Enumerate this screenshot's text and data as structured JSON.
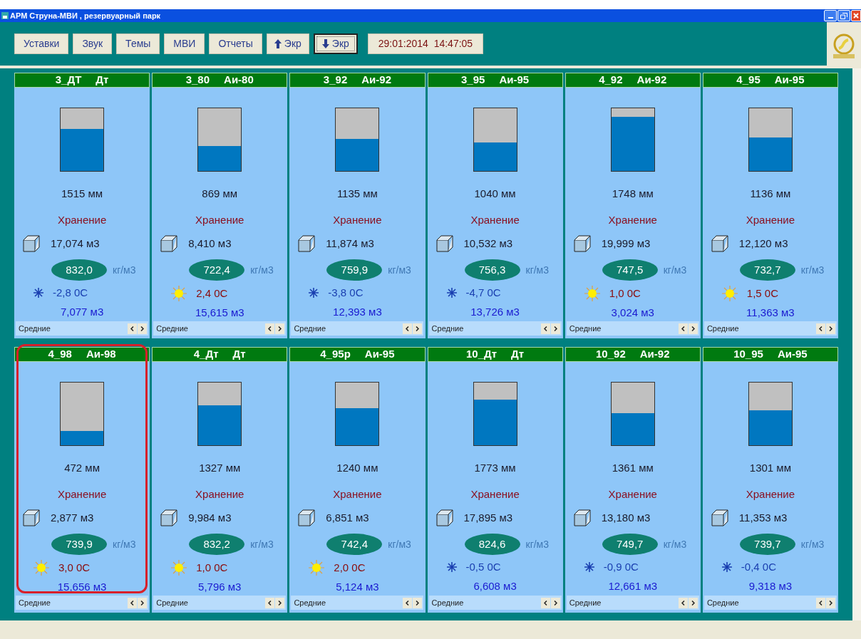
{
  "window": {
    "title": "АРМ Струна-МВИ ,  резервуарный  парк"
  },
  "toolbar": {
    "buttons": [
      {
        "label": "Уставки",
        "kind": "text"
      },
      {
        "label": "Звук",
        "kind": "text"
      },
      {
        "label": "Темы",
        "kind": "text"
      },
      {
        "label": "МВИ",
        "kind": "text"
      },
      {
        "label": "Отчеты",
        "kind": "text"
      },
      {
        "label": "Экр",
        "kind": "up",
        "selected": false
      },
      {
        "label": "Экр",
        "kind": "down",
        "selected": true
      }
    ],
    "datetime": "29:01:2014  14:47:05"
  },
  "tanks": [
    {
      "name": "3_ДТ",
      "product": "Дт",
      "level": 0.67,
      "height": "1515 мм",
      "mode": "Хранение",
      "volume": "17,074 м3",
      "density": "832,0",
      "density_unit": "кг/м3",
      "frost": true,
      "temperature": "-2,8 0С",
      "free_volume": "7,077 м3",
      "footer": "Средние",
      "selected": false
    },
    {
      "name": "3_80",
      "product": "Аи-80",
      "level": 0.4,
      "height": "869 мм",
      "mode": "Хранение",
      "volume": "8,410 м3",
      "density": "722,4",
      "density_unit": "кг/м3",
      "frost": false,
      "temperature": "2,4 0С",
      "free_volume": "15,615 м3",
      "footer": "Средние",
      "selected": false
    },
    {
      "name": "3_92",
      "product": "Аи-92",
      "level": 0.51,
      "height": "1135 мм",
      "mode": "Хранение",
      "volume": "11,874 м3",
      "density": "759,9",
      "density_unit": "кг/м3",
      "frost": true,
      "temperature": "-3,8 0С",
      "free_volume": "12,393 м3",
      "footer": "Средние",
      "selected": false
    },
    {
      "name": "3_95",
      "product": "Аи-95",
      "level": 0.45,
      "height": "1040 мм",
      "mode": "Хранение",
      "volume": "10,532 м3",
      "density": "756,3",
      "density_unit": "кг/м3",
      "frost": true,
      "temperature": "-4,7 0С",
      "free_volume": "13,726 м3",
      "footer": "Средние",
      "selected": false
    },
    {
      "name": "4_92",
      "product": "Аи-92",
      "level": 0.86,
      "height": "1748 мм",
      "mode": "Хранение",
      "volume": "19,999 м3",
      "density": "747,5",
      "density_unit": "кг/м3",
      "frost": false,
      "temperature": "1,0 0С",
      "free_volume": "3,024 м3",
      "footer": "Средние",
      "selected": false
    },
    {
      "name": "4_95",
      "product": "Аи-95",
      "level": 0.53,
      "height": "1136 мм",
      "mode": "Хранение",
      "volume": "12,120 м3",
      "density": "732,7",
      "density_unit": "кг/м3",
      "frost": false,
      "temperature": "1,5 0С",
      "free_volume": "11,363 м3",
      "footer": "Средние",
      "selected": false
    },
    {
      "name": "4_98",
      "product": "Аи-98",
      "level": 0.23,
      "height": "472 мм",
      "mode": "Хранение",
      "volume": "2,877 м3",
      "density": "739,9",
      "density_unit": "кг/м3",
      "frost": false,
      "temperature": "3,0 0С",
      "free_volume": "15,656 м3",
      "footer": "Средние",
      "selected": true
    },
    {
      "name": "4_Дт",
      "product": "Дт",
      "level": 0.64,
      "height": "1327 мм",
      "mode": "Хранение",
      "volume": "9,984 м3",
      "density": "832,2",
      "density_unit": "кг/м3",
      "frost": false,
      "temperature": "1,0 0С",
      "free_volume": "5,796 м3",
      "footer": "Средние",
      "selected": false
    },
    {
      "name": "4_95р",
      "product": "Аи-95",
      "level": 0.59,
      "height": "1240 мм",
      "mode": "Хранение",
      "volume": "6,851 м3",
      "density": "742,4",
      "density_unit": "кг/м3",
      "frost": false,
      "temperature": "2,0 0С",
      "free_volume": "5,124 м3",
      "footer": "Средние",
      "selected": false
    },
    {
      "name": "10_Дт",
      "product": "Дт",
      "level": 0.73,
      "height": "1773 мм",
      "mode": "Хранение",
      "volume": "17,895 м3",
      "density": "824,6",
      "density_unit": "кг/м3",
      "frost": true,
      "temperature": "-0,5 0С",
      "free_volume": "6,608 м3",
      "footer": "Средние",
      "selected": false
    },
    {
      "name": "10_92",
      "product": "Аи-92",
      "level": 0.51,
      "height": "1361 мм",
      "mode": "Хранение",
      "volume": "13,180 м3",
      "density": "749,7",
      "density_unit": "кг/м3",
      "frost": true,
      "temperature": "-0,9 0С",
      "free_volume": "12,661 м3",
      "footer": "Средние",
      "selected": false
    },
    {
      "name": "10_95",
      "product": "Аи-95",
      "level": 0.56,
      "height": "1301 мм",
      "mode": "Хранение",
      "volume": "11,353 м3",
      "density": "739,7",
      "density_unit": "кг/м3",
      "frost": true,
      "temperature": "-0,4 0С",
      "free_volume": "9,318 м3",
      "footer": "Средние",
      "selected": false
    }
  ]
}
